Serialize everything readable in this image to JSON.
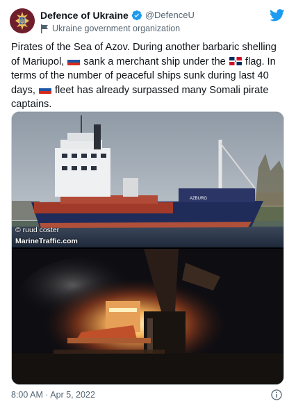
{
  "author": {
    "display_name": "Defence of Ukraine",
    "handle": "@DefenceU",
    "org_label": "Ukraine government organization",
    "avatar_icon": "ukraine-defence-emblem-icon",
    "verified_icon": "verified-badge-icon",
    "org_icon": "government-flag-icon"
  },
  "brand": {
    "logo_icon": "twitter-bird-icon",
    "accent": "#1d9bf0"
  },
  "tweet": {
    "part1": "Pirates of the Sea of Azov. During another barbaric shelling of Mariupol, ",
    "part2": " sank a merchant ship under the ",
    "part3": " flag. In terms of the number of peaceful ships sunk during last 40 days, ",
    "part4": " fleet has already surpassed many Somali pirate captains.",
    "flag1": "russia-flag-icon",
    "flag2": "dominican-republic-flag-icon",
    "flag3": "russia-flag-icon"
  },
  "media": {
    "photo1_icon": "cargo-ship-photo",
    "photo2_icon": "burning-ship-night-photo",
    "watermark_credit": "© ruud coster",
    "watermark_site": "MarineTraffic.com",
    "ship_name": "AZBURG"
  },
  "footer": {
    "timestamp": "8:00 AM · Apr 5, 2022",
    "info_icon": "info-circle-icon"
  }
}
